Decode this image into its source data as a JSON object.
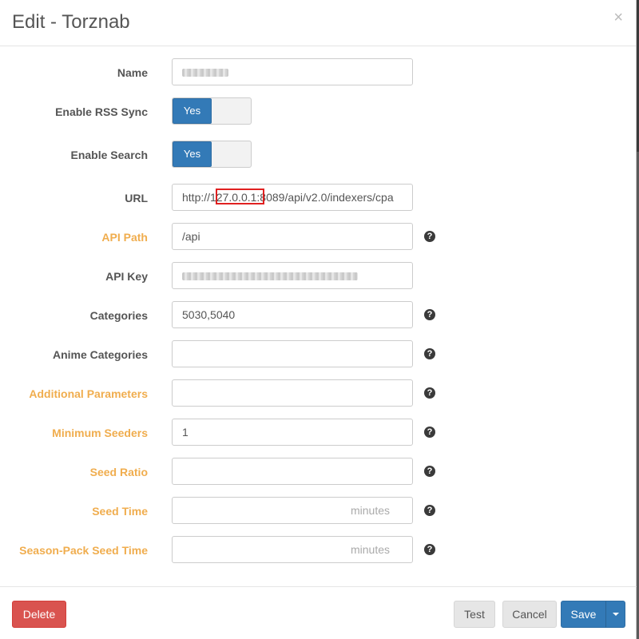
{
  "modal": {
    "title": "Edit - Torznab",
    "close_glyph": "×"
  },
  "fields": {
    "name": {
      "label": "Name",
      "value": ""
    },
    "enable_rss_sync": {
      "label": "Enable RSS Sync",
      "toggle_label": "Yes"
    },
    "enable_search": {
      "label": "Enable Search",
      "toggle_label": "Yes"
    },
    "url": {
      "label": "URL",
      "value": "http://127.0.0.1:8089/api/v2.0/indexers/cpa"
    },
    "api_path": {
      "label": "API Path",
      "value": "/api"
    },
    "api_key": {
      "label": "API Key",
      "value": ""
    },
    "categories": {
      "label": "Categories",
      "value": "5030,5040"
    },
    "anime_categories": {
      "label": "Anime Categories",
      "value": ""
    },
    "additional_parameters": {
      "label": "Additional Parameters",
      "value": ""
    },
    "minimum_seeders": {
      "label": "Minimum Seeders",
      "value": "1"
    },
    "seed_ratio": {
      "label": "Seed Ratio",
      "value": ""
    },
    "seed_time": {
      "label": "Seed Time",
      "value": "",
      "suffix": "minutes"
    },
    "season_pack_seed_time": {
      "label": "Season-Pack Seed Time",
      "value": "",
      "suffix": "minutes"
    }
  },
  "help_glyph": "?",
  "footer": {
    "delete_label": "Delete",
    "test_label": "Test",
    "cancel_label": "Cancel",
    "save_label": "Save"
  },
  "colors": {
    "primary": "#337ab7",
    "danger": "#d9534f",
    "advanced_label": "#f0ad4e",
    "highlight": "#e02020"
  }
}
